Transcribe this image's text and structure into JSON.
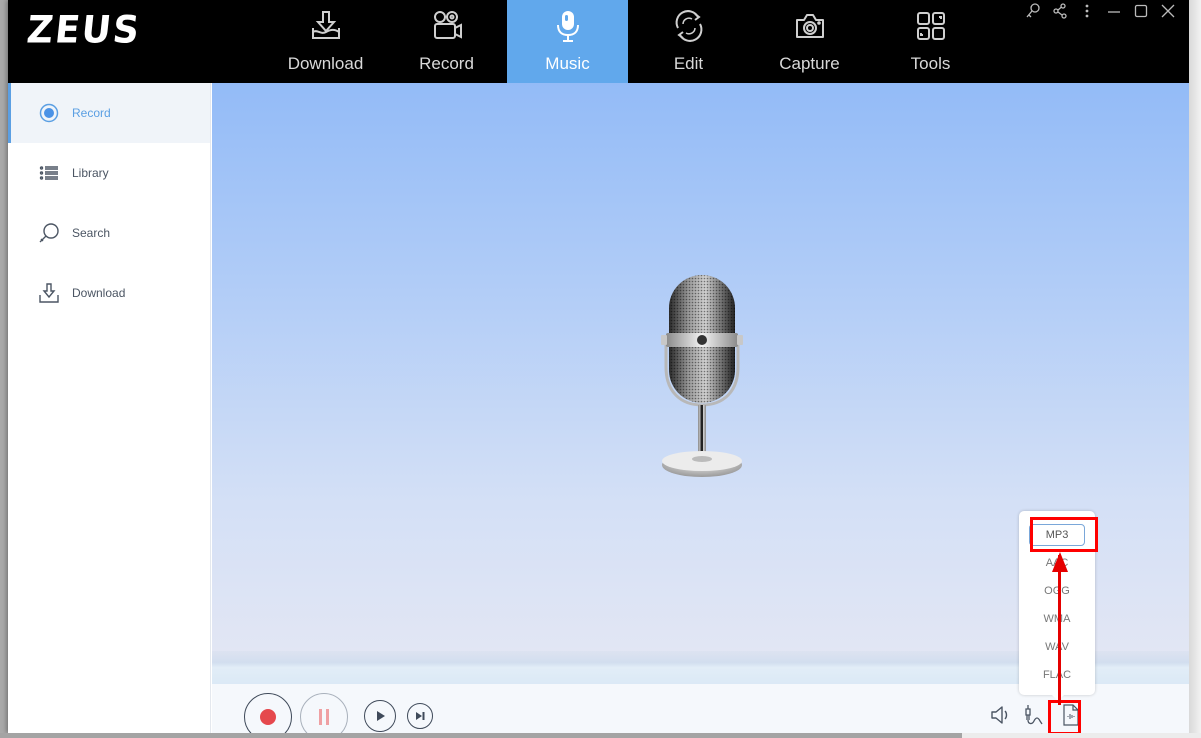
{
  "app": {
    "logo": "ZEUS"
  },
  "nav": {
    "tabs": [
      {
        "label": "Download",
        "icon": "download-tray-icon",
        "active": false
      },
      {
        "label": "Record",
        "icon": "video-camera-icon",
        "active": false
      },
      {
        "label": "Music",
        "icon": "microphone-icon",
        "active": true
      },
      {
        "label": "Edit",
        "icon": "refresh-cycle-icon",
        "active": false
      },
      {
        "label": "Capture",
        "icon": "camera-icon",
        "active": false
      },
      {
        "label": "Tools",
        "icon": "grid-tools-icon",
        "active": false
      }
    ]
  },
  "window_controls": [
    "key-icon",
    "share-icon",
    "more-icon",
    "minimize-icon",
    "maximize-icon",
    "close-icon"
  ],
  "sidebar": {
    "items": [
      {
        "label": "Record",
        "icon": "radio-record-icon",
        "active": true
      },
      {
        "label": "Library",
        "icon": "list-icon",
        "active": false
      },
      {
        "label": "Search",
        "icon": "search-icon",
        "active": false
      },
      {
        "label": "Download",
        "icon": "download-icon",
        "active": false
      }
    ]
  },
  "format_menu": {
    "options": [
      "MP3",
      "AAC",
      "OGG",
      "WMA",
      "WAV",
      "FLAC"
    ],
    "selected": "MP3"
  },
  "colors": {
    "accent": "#61a8ec",
    "record": "#e5484d",
    "highlight": "#ff0000"
  }
}
